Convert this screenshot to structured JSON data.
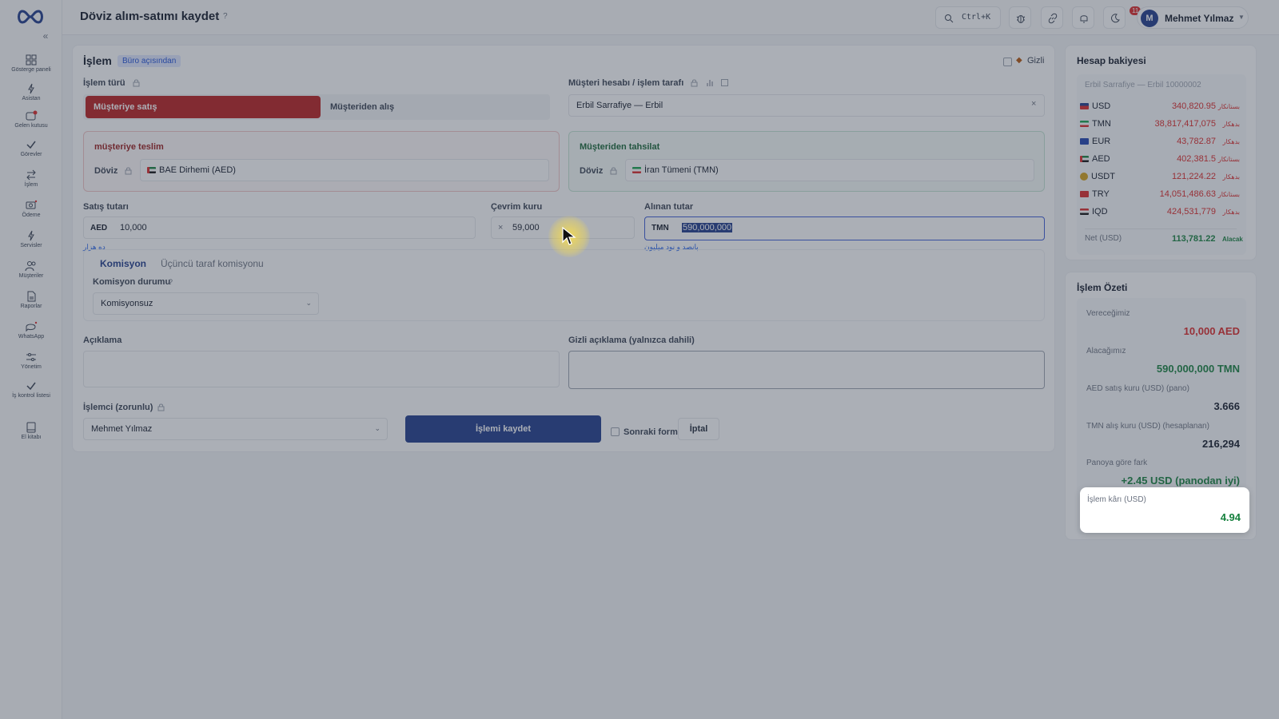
{
  "header": {
    "title": "Döviz alım-satımı kaydet",
    "help_icon": "question-mark",
    "search_shortcut": "Ctrl+K",
    "notification_count": "11",
    "user_name": "Mehmet Yılmaz",
    "user_initial": "M"
  },
  "sidebar": {
    "items": [
      {
        "label": "Gösterge paneli",
        "icon": "dashboard-icon"
      },
      {
        "label": "Asistan",
        "icon": "sparkle-icon"
      },
      {
        "label": "Gelen kutusu",
        "icon": "inbox-icon"
      },
      {
        "label": "Görevler",
        "icon": "check-icon"
      },
      {
        "label": "İşlem",
        "icon": "arrows-icon"
      },
      {
        "label": "Ödeme",
        "icon": "payment-icon"
      },
      {
        "label": "Servisler",
        "icon": "bolt-icon"
      },
      {
        "label": "Müşteriler",
        "icon": "users-icon"
      },
      {
        "label": "Raporlar",
        "icon": "report-icon"
      },
      {
        "label": "WhatsApp",
        "icon": "chat-icon"
      },
      {
        "label": "Yönetim",
        "icon": "sliders-icon"
      },
      {
        "label": "İş kontrol listesi",
        "icon": "checklist-icon"
      },
      {
        "label": "El kitabı",
        "icon": "book-icon"
      }
    ]
  },
  "form": {
    "section_title": "İşlem",
    "perspective_tag": "Büro açısından",
    "hidden_label": "Gizli",
    "type_label": "İşlem türü",
    "type_options": [
      "Müşteriye satış",
      "Müşteriden alış"
    ],
    "account_label": "Müşteri hesabı / işlem tarafı",
    "account_value": "Erbil Sarrafiye — Erbil",
    "deliver_title": "müşteriye teslim",
    "collect_title": "Müşteriden tahsilat",
    "currency_label": "Döviz",
    "deliver_currency": "BAE Dirhemi (AED)",
    "collect_currency": "İran Tümeni (TMN)",
    "sale_amount_label": "Satış tutarı",
    "sale_currency": "AED",
    "sale_amount": "10,000",
    "sale_words": "ده هزار",
    "rate_label": "Çevrim kuru",
    "rate_op": "×",
    "rate_value": "59,000",
    "received_label": "Alınan tutar",
    "received_currency": "TMN",
    "received_amount": "590,000,000",
    "received_words": "پانصد و نود میلیون",
    "commission_tabs": [
      "Komisyon",
      "Üçüncü taraf komisyonu"
    ],
    "commission_status_label": "Komisyon durumu",
    "commission_status_value": "Komisyonsuz",
    "description_label": "Açıklama",
    "hidden_description_label": "Gizli açıklama (yalnızca dahili)",
    "operator_label": "İşlemci (zorunlu)",
    "operator_value": "Mehmet Yılmaz",
    "save_button": "İşlemi kaydet",
    "next_form_label": "Sonraki form",
    "cancel_button": "İptal"
  },
  "balance": {
    "title": "Hesap bakiyesi",
    "account": "Erbil Sarrafiye — Erbil 10000002",
    "rows": [
      {
        "code": "USD",
        "amount": "340,820.95",
        "dir": "بستانکار",
        "color": "#dc2626"
      },
      {
        "code": "TMN",
        "amount": "38,817,417,075",
        "dir": "بدهکار",
        "color": "#dc2626"
      },
      {
        "code": "EUR",
        "amount": "43,782.87",
        "dir": "بدهکار",
        "color": "#dc2626"
      },
      {
        "code": "AED",
        "amount": "402,381.5",
        "dir": "بستانکار",
        "color": "#dc2626"
      },
      {
        "code": "USDT",
        "amount": "121,224.22",
        "dir": "بدهکار",
        "color": "#dc2626"
      },
      {
        "code": "TRY",
        "amount": "14,051,486.63",
        "dir": "بستانکار",
        "color": "#dc2626"
      },
      {
        "code": "IQD",
        "amount": "424,531,779",
        "dir": "بدهکار",
        "color": "#dc2626"
      }
    ],
    "net_label": "Net (USD)",
    "net_value": "113,781.22",
    "net_dir": "Alacak"
  },
  "summary": {
    "title": "İşlem Özeti",
    "give_label": "Vereceğimiz",
    "give_value": "10,000 AED",
    "receive_label": "Alacağımız",
    "receive_value": "590,000,000 TMN",
    "aed_rate_label": "AED satış kuru (USD) (pano)",
    "aed_rate_value": "3.666",
    "tmn_rate_label": "TMN alış kuru (USD) (hesaplanan)",
    "tmn_rate_value": "216,294",
    "diff_label": "Panoya göre fark",
    "diff_value": "+2.45 USD (panodan iyi)",
    "profit_label": "İşlem kârı (USD)",
    "profit_value": "4.94"
  },
  "colors": {
    "accent_red": "#b91c1c",
    "primary_blue": "#1e3a8a",
    "positive_green": "#15803d",
    "negative_red": "#dc2626"
  }
}
